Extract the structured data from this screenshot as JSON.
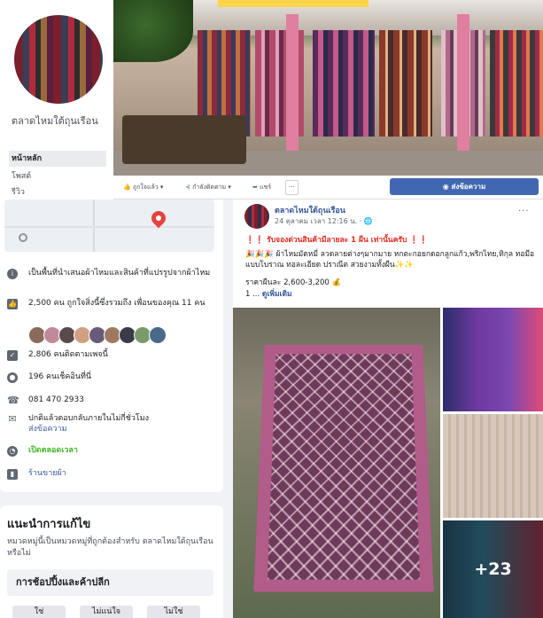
{
  "page": {
    "name": "ตลาดไหมใต้ถุนเรือน",
    "nav": [
      "หน้าหลัก",
      "โพสต์",
      "รีวิว"
    ]
  },
  "action_bar": {
    "like": "ถูกใจแล้ว",
    "follow": "กำลังติดตาม",
    "share": "แชร์",
    "more": "···",
    "send_message": "ส่งข้อความ"
  },
  "about": {
    "description": "เป็นพื้นที่นำเสนอผ้าไหมและสินค้าที่แปรรูปจากผ้าไหม",
    "likes": "2,500 คน ถูกใจสิ่งนี้ซึ่งรวมถึง เพื่อนของคุณ 11 คน",
    "follows": "2,806 คนติดตามเพจนี้",
    "checkins": "196 คนเช็คอินที่นี่",
    "phone": "081 470 2933",
    "response": "ปกติแล้วตอบกลับภายในไม่กี่ชั่วโมง",
    "send_message": "ส่งข้อความ",
    "hours": "เปิดตลอดเวลา",
    "category": "ร้านขายผ้า"
  },
  "suggest": {
    "title": "แนะนำการแก้ไข",
    "body": "หมวดหมู่นี้เป็นหมวดหมู่ที่ถูกต้องสำหรับ ตลาดไหมใต้ถุนเรือน หรือไม่",
    "category": "การช้อปปิ้งและค้าปลีก",
    "choices": [
      "ใช่",
      "ไม่แน่ใจ",
      "ไม่ใช่"
    ]
  },
  "post": {
    "author": "ตลาดไหมใต้ถุนเรือน",
    "time": "24 ตุลาคม เวลา 12:16 น. · 🌐",
    "line1": "❗❗ รับจองด่วนสินค้ามีลายละ 1 ผืน เท่านั้นครับ ❗❗",
    "line2": "🎉🎉🎉 ผ้าไหมมัดหมี่ ลวดลายต่างๆมากมาย หกตะกอยกดอกลูกแก้ว,พริกไทย,ทิกุล ทอมือแบบโบราณ ทอละเอียด ปราณีต สวยงามทั้งผืน✨✨",
    "line3": "ราคาผืนละ 2,600-3,200 💰",
    "see_more_prefix": "1 ... ",
    "see_more": "ดูเพิ่มเติม",
    "more_photos": "+23"
  },
  "colors": {
    "facebook_blue": "#4267b2",
    "link_blue": "#385898",
    "open_green": "#42b72a"
  }
}
